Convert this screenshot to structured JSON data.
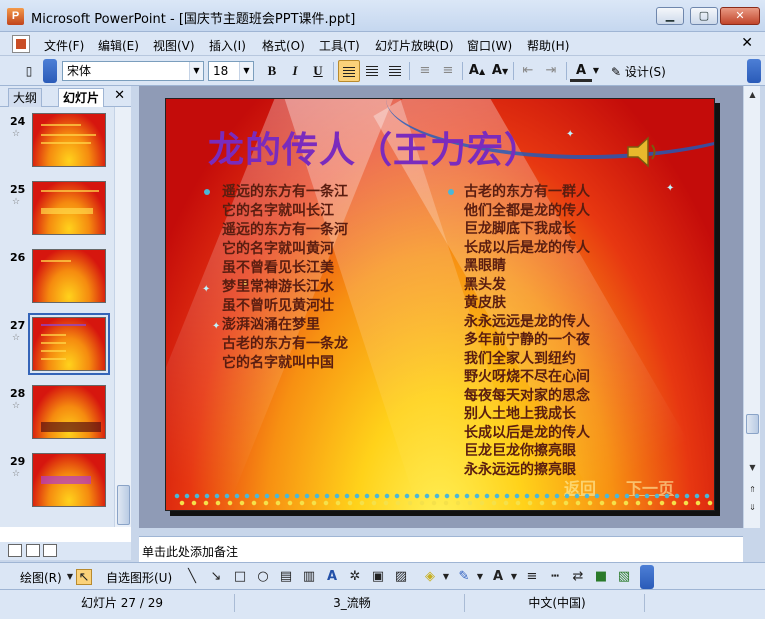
{
  "window": {
    "title": "Microsoft PowerPoint - [国庆节主题班会PPT课件.ppt]"
  },
  "menu": [
    "文件(F)",
    "编辑(E)",
    "视图(V)",
    "插入(I)",
    "格式(O)",
    "工具(T)",
    "幻灯片放映(D)",
    "窗口(W)",
    "帮助(H)"
  ],
  "toolbar": {
    "font": "宋体",
    "size": "18",
    "design_label": "设计(S)"
  },
  "pane": {
    "tab_outline": "大纲",
    "tab_slides": "幻灯片"
  },
  "thumbnails": [
    {
      "num": "24",
      "star": "☆"
    },
    {
      "num": "25",
      "star": "☆"
    },
    {
      "num": "26",
      "star": ""
    },
    {
      "num": "27",
      "star": "☆"
    },
    {
      "num": "28",
      "star": "☆"
    },
    {
      "num": "29",
      "star": "☆"
    }
  ],
  "slide": {
    "title": "龙的传人（王力宏）",
    "col1": [
      "遥远的东方有一条江",
      "它的名字就叫长江",
      "遥远的东方有一条河",
      "它的名字就叫黄河",
      "虽不曾看见长江美",
      "梦里常神游长江水",
      "虽不曾听见黄河壮",
      "澎湃汹涌在梦里",
      "古老的东方有一条龙",
      "它的名字就叫中国"
    ],
    "col2": [
      "古老的东方有一群人",
      "他们全都是龙的传人",
      "巨龙脚底下我成长",
      "长成以后是龙的传人",
      "黑眼睛",
      "黑头发",
      "黄皮肤",
      "永永远远是龙的传人",
      "多年前宁静的一个夜",
      "我们全家人到纽约",
      "野火呀烧不尽在心间",
      "每夜每天对家的思念",
      "别人土地上我成长",
      "长成以后是龙的传人",
      "巨龙巨龙你擦亮眼",
      "永永远远的擦亮眼"
    ],
    "nav_back": "返回",
    "nav_next": "下一页"
  },
  "notes": {
    "placeholder": "单击此处添加备注"
  },
  "drawbar": {
    "draw_label": "绘图(R)",
    "autoshape_label": "自选图形(U)"
  },
  "status": {
    "slide_info": "幻灯片 27 / 29",
    "design": "3_流畅",
    "language": "中文(中国)"
  }
}
